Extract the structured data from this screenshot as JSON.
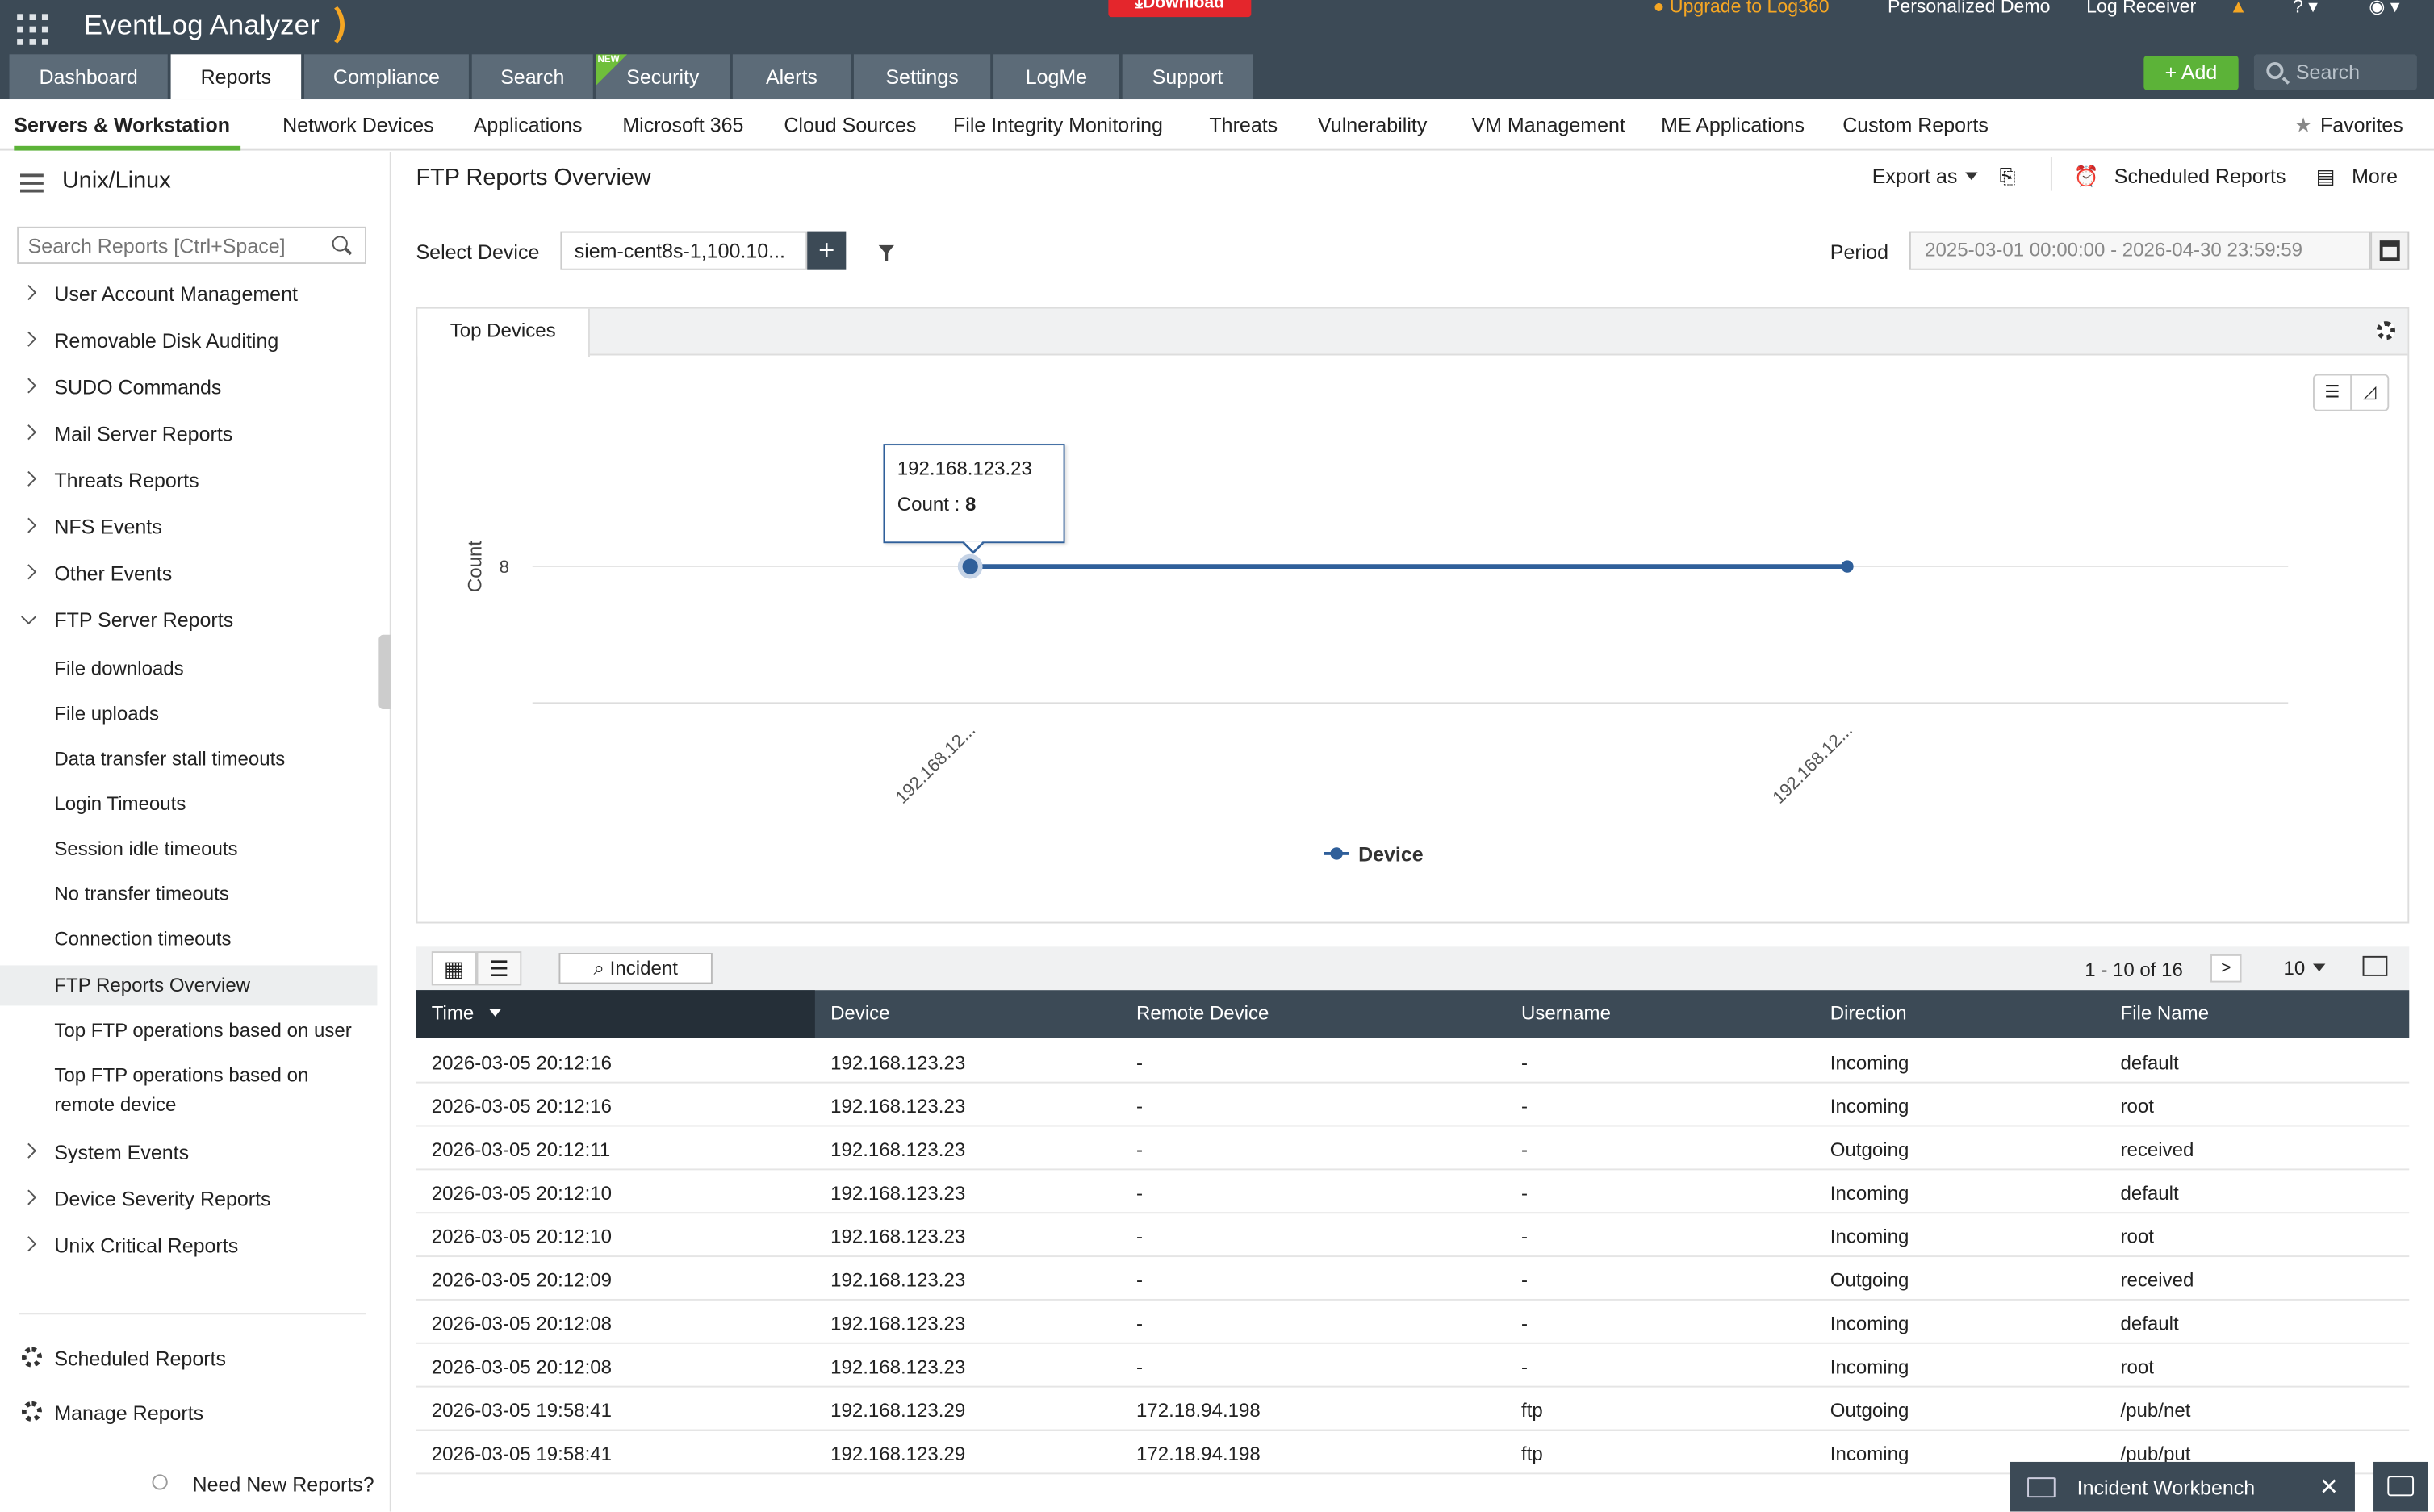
{
  "app": {
    "title": "EventLog Analyzer",
    "download": "Download",
    "upgrade": "Upgrade to Log360",
    "demo": "Personalized Demo",
    "log_receiver": "Log Receiver"
  },
  "nav": {
    "tabs": [
      {
        "label": "Dashboard"
      },
      {
        "label": "Reports",
        "active": true
      },
      {
        "label": "Compliance"
      },
      {
        "label": "Search"
      },
      {
        "label": "Security",
        "badge": "NEW"
      },
      {
        "label": "Alerts"
      },
      {
        "label": "Settings"
      },
      {
        "label": "LogMe"
      },
      {
        "label": "Support"
      }
    ],
    "add_label": "Add",
    "search_placeholder": "Search"
  },
  "subnav": {
    "items": [
      "Servers & Workstation",
      "Network Devices",
      "Applications",
      "Microsoft 365",
      "Cloud Sources",
      "File Integrity Monitoring",
      "Threats",
      "Vulnerability",
      "VM Management",
      "ME Applications",
      "Custom Reports"
    ],
    "favorites": "Favorites"
  },
  "sidebar": {
    "title": "Unix/Linux",
    "search_placeholder": "Search Reports [Ctrl+Space]",
    "categories": [
      "User Account Management",
      "Removable Disk Auditing",
      "SUDO Commands",
      "Mail Server Reports",
      "Threats Reports",
      "NFS Events",
      "Other Events",
      "FTP Server Reports"
    ],
    "ftp_items": [
      "File downloads",
      "File uploads",
      "Data transfer stall timeouts",
      "Login Timeouts",
      "Session idle timeouts",
      "No transfer timeouts",
      "Connection timeouts",
      "FTP Reports Overview",
      "Top FTP operations based on user",
      "Top FTP operations based on",
      "remote device"
    ],
    "categories_after": [
      "System Events",
      "Device Severity Reports",
      "Unix Critical Reports"
    ],
    "scheduled": "Scheduled Reports",
    "manage": "Manage Reports",
    "need_new": "Need New Reports?"
  },
  "main": {
    "title": "FTP Reports Overview",
    "export_as": "Export as",
    "scheduled_reports": "Scheduled Reports",
    "more": "More",
    "select_device_label": "Select Device",
    "device_value": "siem-cent8s-1,100.10...",
    "period_label": "Period",
    "period_value": "2025-03-01 00:00:00 - 2026-04-30 23:59:59",
    "chart_tab": "Top Devices"
  },
  "chart_data": {
    "type": "line",
    "categories": [
      "192.168.12...",
      "192.168.12..."
    ],
    "series": [
      {
        "name": "Device",
        "values": [
          8,
          8
        ]
      }
    ],
    "ylabel": "Count",
    "yticks": [
      8
    ],
    "tooltip": {
      "title": "192.168.123.23",
      "label": "Count : ",
      "value": "8"
    },
    "color": "#2f5f9a"
  },
  "table": {
    "incident_btn": "Incident",
    "pager": "1 - 10 of 16",
    "page_size": "10",
    "headers": [
      "Time",
      "Device",
      "Remote Device",
      "Username",
      "Direction",
      "File Name"
    ],
    "rows": [
      [
        "2026-03-05 20:12:16",
        "192.168.123.23",
        "-",
        "-",
        "Incoming",
        "default"
      ],
      [
        "2026-03-05 20:12:16",
        "192.168.123.23",
        "-",
        "-",
        "Incoming",
        "root"
      ],
      [
        "2026-03-05 20:12:11",
        "192.168.123.23",
        "-",
        "-",
        "Outgoing",
        "received"
      ],
      [
        "2026-03-05 20:12:10",
        "192.168.123.23",
        "-",
        "-",
        "Incoming",
        "default"
      ],
      [
        "2026-03-05 20:12:10",
        "192.168.123.23",
        "-",
        "-",
        "Incoming",
        "root"
      ],
      [
        "2026-03-05 20:12:09",
        "192.168.123.23",
        "-",
        "-",
        "Outgoing",
        "received"
      ],
      [
        "2026-03-05 20:12:08",
        "192.168.123.23",
        "-",
        "-",
        "Incoming",
        "default"
      ],
      [
        "2026-03-05 20:12:08",
        "192.168.123.23",
        "-",
        "-",
        "Incoming",
        "root"
      ],
      [
        "2026-03-05 19:58:41",
        "192.168.123.29",
        "172.18.94.198",
        "ftp",
        "Outgoing",
        "/pub/net"
      ],
      [
        "2026-03-05 19:58:41",
        "192.168.123.29",
        "172.18.94.198",
        "ftp",
        "Incoming",
        "/pub/put"
      ]
    ]
  },
  "workbench": {
    "label": "Incident Workbench"
  },
  "colors": {
    "header": "#3c4a56",
    "accent": "#5cb338",
    "download": "#e4262c",
    "series": "#2f5f9a"
  }
}
